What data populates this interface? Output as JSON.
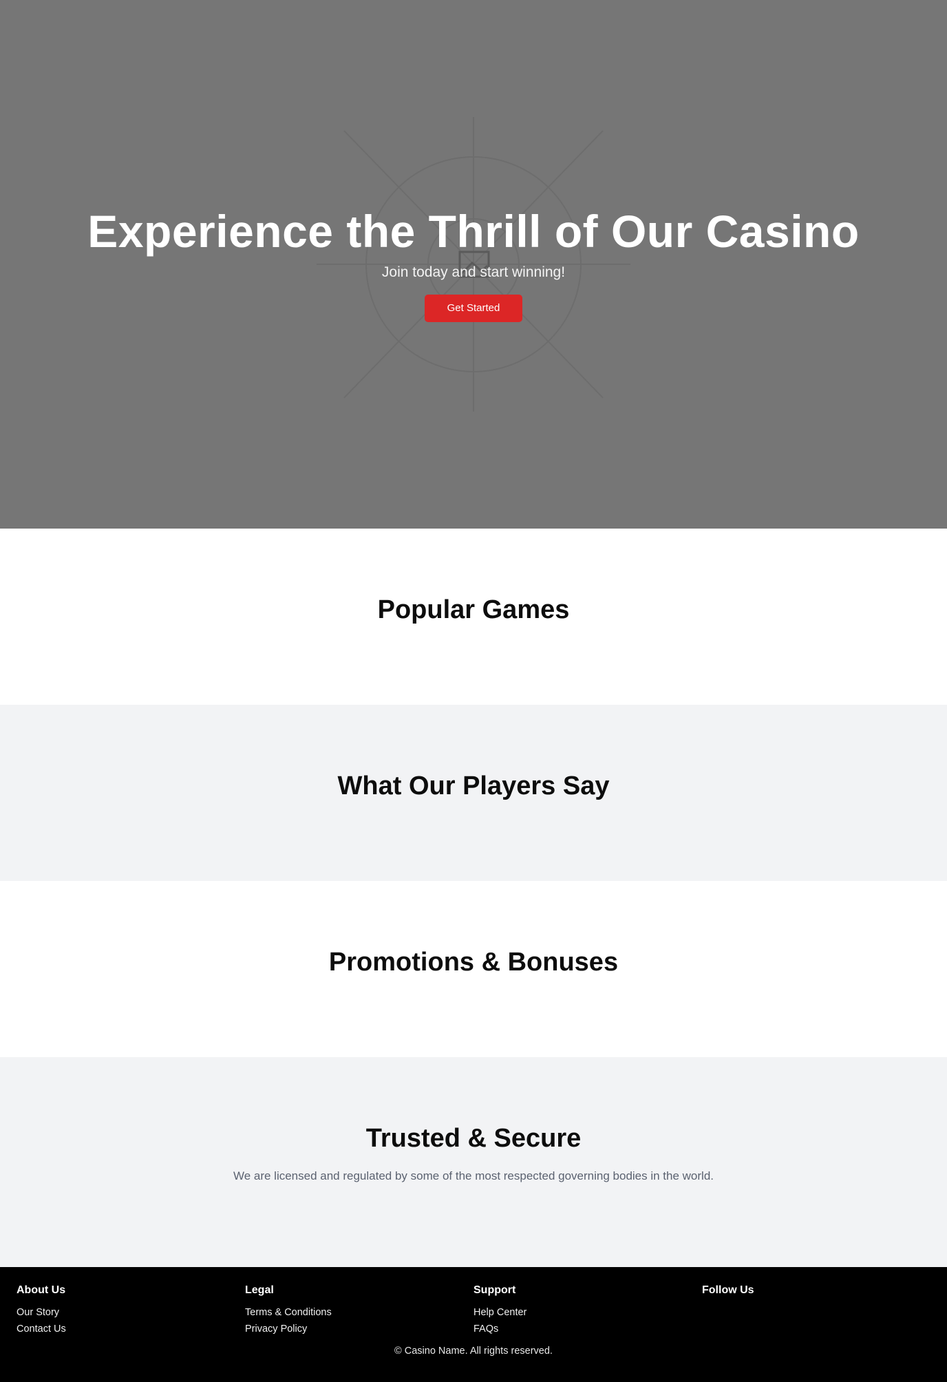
{
  "hero": {
    "title": "Experience the Thrill of Our Casino",
    "subtitle": "Join today and start winning!",
    "cta_label": "Get Started",
    "background_color": "#767676",
    "accent_color": "#dc2626"
  },
  "sections": {
    "popular_games": {
      "title": "Popular Games"
    },
    "testimonials": {
      "title": "What Our Players Say"
    },
    "promotions": {
      "title": "Promotions & Bonuses"
    },
    "trusted": {
      "title": "Trusted & Secure",
      "text": "We are licensed and regulated by some of the most respected governing bodies in the world."
    }
  },
  "footer": {
    "columns": [
      {
        "title": "About Us",
        "links": [
          "Our Story",
          "Contact Us"
        ]
      },
      {
        "title": "Legal",
        "links": [
          "Terms & Conditions",
          "Privacy Policy"
        ]
      },
      {
        "title": "Support",
        "links": [
          "Help Center",
          "FAQs"
        ]
      },
      {
        "title": "Follow Us",
        "links": []
      }
    ],
    "copyright": "© Casino Name. All rights reserved."
  }
}
